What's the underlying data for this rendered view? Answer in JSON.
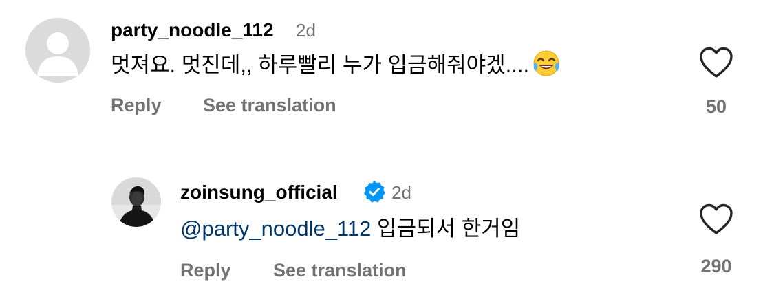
{
  "comments": [
    {
      "username": "party_noodle_112",
      "time": "2d",
      "text": "멋져요. 멋진데,, 하루빨리 누가 입금해줘야겠....",
      "emoji": "tears-of-joy-emoji",
      "reply_label": "Reply",
      "translate_label": "See translation",
      "likes": "50",
      "avatar": "default-avatar-icon"
    },
    {
      "username": "zoinsung_official",
      "time": "2d",
      "verified": true,
      "verified_color": "#0095f6",
      "mention": "@party_noodle_112",
      "text": " 입금되서 한거임",
      "reply_label": "Reply",
      "translate_label": "See translation",
      "likes": "290",
      "avatar": "profile-photo"
    }
  ],
  "colors": {
    "text": "#000000",
    "secondary": "#737373",
    "mention": "#00376b",
    "avatar_placeholder": "#dbdbdb"
  }
}
